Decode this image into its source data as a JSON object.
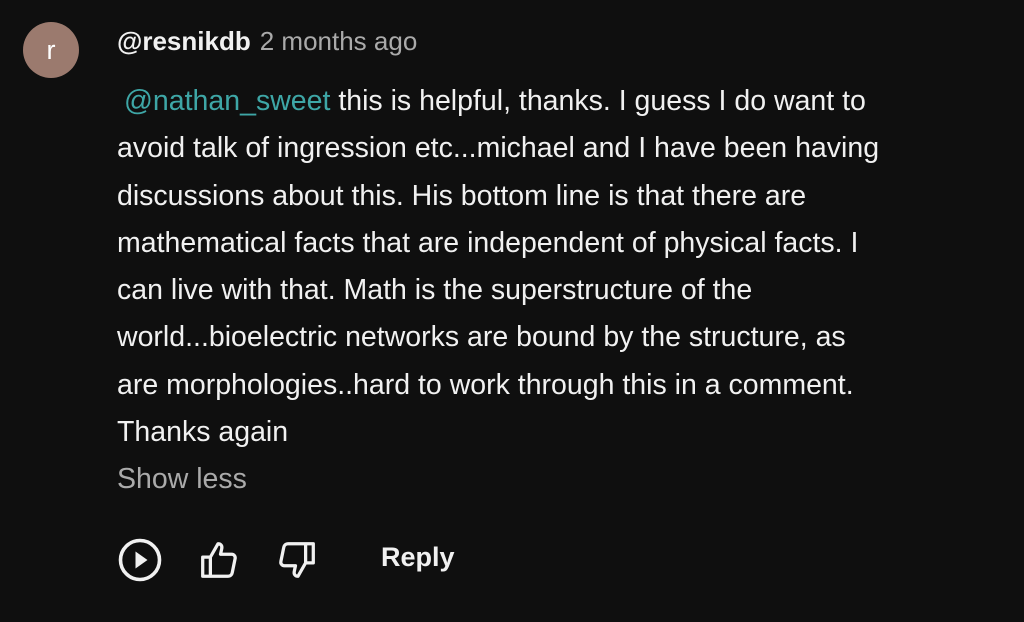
{
  "comment": {
    "avatar_initial": "r",
    "author": "@resnikdb",
    "timestamp": "2 months ago",
    "mention": "@nathan_sweet",
    "body_lines": [
      "this is helpful, thanks. I guess I do want to",
      "avoid talk of ingression etc...michael and I have been having",
      "discussions about this. His bottom line is that there are",
      "mathematical facts that are independent of physical facts. I",
      "can live with that. Math is the superstructure of the",
      "world...bioelectric networks are bound by the structure, as",
      "are morphologies..hard to work through this in a comment.",
      "Thanks again"
    ],
    "show_less_label": "Show less"
  },
  "actions": {
    "play_icon": "play-circle-icon",
    "like_icon": "thumbs-up-icon",
    "dislike_icon": "thumbs-down-icon",
    "reply_label": "Reply"
  },
  "colors": {
    "background": "#0f0f0f",
    "text": "#f1f1f1",
    "secondary_text": "#aaaaaa",
    "mention": "#3ea6a6",
    "avatar": "#9b7a6e"
  }
}
